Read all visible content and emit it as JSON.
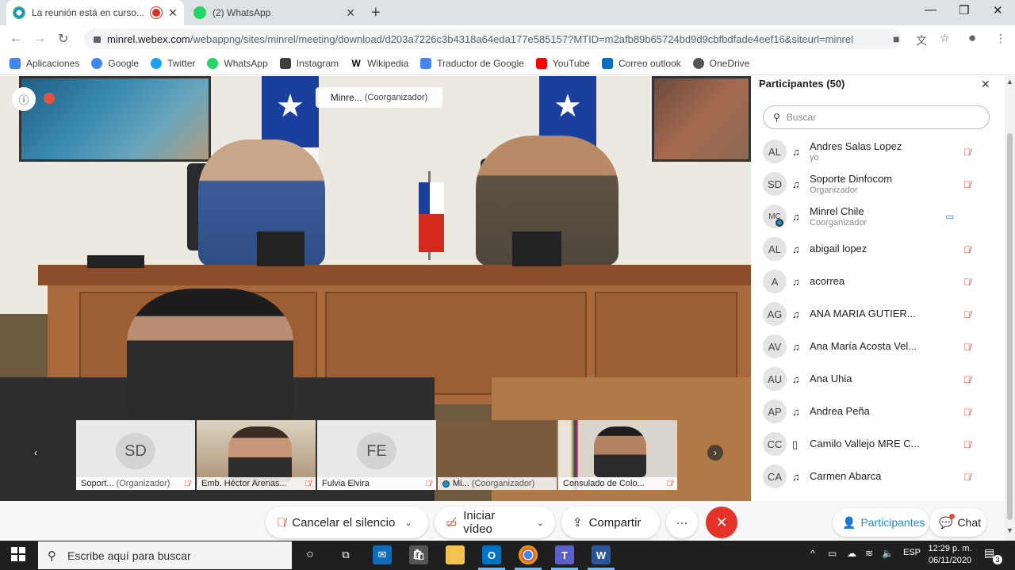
{
  "tabs": [
    {
      "title": "La reunión está en curso...",
      "active": true,
      "recording": true
    },
    {
      "title": "(2) WhatsApp",
      "active": false
    }
  ],
  "address": {
    "host": "minrel.webex.com",
    "path": "/webappng/sites/minrel/meeting/download/d203a7226c3b4318a64eda177e585157?MTID=m2afb89b65724bd9d9cbfbdfade4eef16&siteurl=minrel"
  },
  "bookmarks": [
    {
      "label": "Aplicaciones",
      "icon": "apps-grid-icon",
      "color": "#4285f4"
    },
    {
      "label": "Google",
      "icon": "google-icon",
      "color": "#4285f4"
    },
    {
      "label": "Twitter",
      "icon": "twitter-icon",
      "color": "#1da1f2"
    },
    {
      "label": "WhatsApp",
      "icon": "whatsapp-icon",
      "color": "#25d366"
    },
    {
      "label": "Instagram",
      "icon": "instagram-icon",
      "color": "#3f3f3f"
    },
    {
      "label": "Wikipedia",
      "icon": "wikipedia-icon",
      "color": "#000000"
    },
    {
      "label": "Traductor de Google",
      "icon": "translate-icon",
      "color": "#4285f4"
    },
    {
      "label": "YouTube",
      "icon": "youtube-icon",
      "color": "#ff0000"
    },
    {
      "label": "Correo outlook",
      "icon": "outlook-icon",
      "color": "#0072c6"
    },
    {
      "label": "OneDrive",
      "icon": "onedrive-icon",
      "color": "#555555"
    }
  ],
  "video": {
    "presenter_name": "Minre...",
    "presenter_role": "(Coorganizador)"
  },
  "thumbnails": [
    {
      "initials": "SD",
      "name": "Soport...",
      "role": "(Organizador)",
      "muted": true
    },
    {
      "initials": "",
      "name": "Emb. Héctor Arenas...",
      "role": "",
      "muted": true
    },
    {
      "initials": "FE",
      "name": "Fulvia Elvira",
      "role": "",
      "muted": true
    },
    {
      "initials": "",
      "name": "Mi...",
      "role": "(Coorganizador)",
      "muted": false
    },
    {
      "initials": "",
      "name": "Consulado de Colo...",
      "role": "",
      "muted": true
    }
  ],
  "controls": {
    "mute_label": "Cancelar el silencio",
    "video_label": "Iniciar vídeo",
    "share_label": "Compartir",
    "more_label": "···",
    "participants_label": "Participantes",
    "chat_label": "Chat"
  },
  "participants_panel": {
    "title": "Participantes (50)",
    "search_placeholder": "Buscar",
    "items": [
      {
        "initials": "AL",
        "name": "Andres Salas Lopez",
        "sub": "yo",
        "audio": "headset",
        "muted": true
      },
      {
        "initials": "SD",
        "name": "Soporte Dinfocom",
        "sub": "Organizador",
        "audio": "headset",
        "muted": true
      },
      {
        "initials": "MC",
        "name": "Minrel Chile",
        "sub": "Coorganizador",
        "audio": "headset",
        "muted": false,
        "video": true
      },
      {
        "initials": "AL",
        "name": "abigail lopez",
        "sub": "",
        "audio": "headset",
        "muted": true
      },
      {
        "initials": "A",
        "name": "acorrea",
        "sub": "",
        "audio": "headset",
        "muted": true
      },
      {
        "initials": "AG",
        "name": "ANA MARIA GUTIER...",
        "sub": "",
        "audio": "headset",
        "muted": true
      },
      {
        "initials": "AV",
        "name": "Ana María Acosta Vel...",
        "sub": "",
        "audio": "headset",
        "muted": true
      },
      {
        "initials": "AU",
        "name": "Ana Uhia",
        "sub": "",
        "audio": "headset",
        "muted": true
      },
      {
        "initials": "AP",
        "name": "Andrea Peña",
        "sub": "",
        "audio": "headset",
        "muted": true
      },
      {
        "initials": "CC",
        "name": "Camilo Vallejo MRE C...",
        "sub": "",
        "audio": "phone",
        "muted": true
      },
      {
        "initials": "CA",
        "name": "Carmen Abarca",
        "sub": "",
        "audio": "headset",
        "muted": true
      }
    ]
  },
  "taskbar": {
    "search_placeholder": "Escribe aquí para buscar",
    "language": "ESP",
    "time": "12:29 p. m.",
    "date": "06/11/2020",
    "notifications": "3"
  }
}
